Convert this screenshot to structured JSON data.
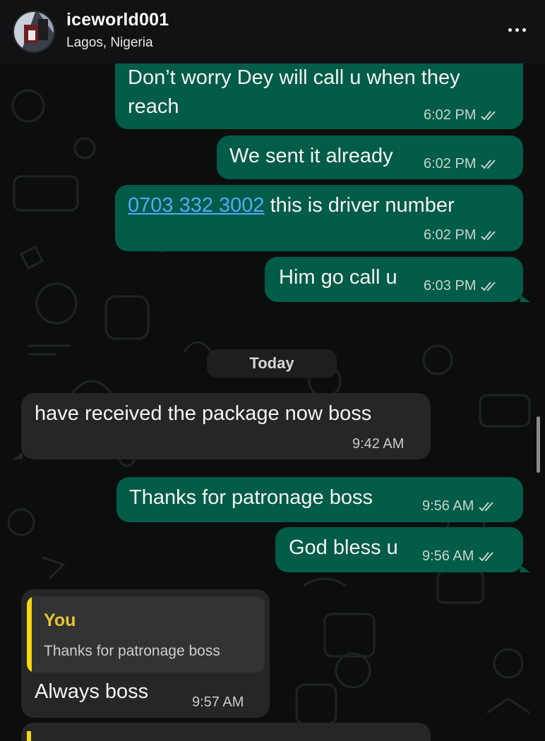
{
  "header": {
    "username": "iceworld001",
    "location": "Lagos, Nigeria",
    "more_icon": "more-horizontal-icon"
  },
  "messages": [
    {
      "direction": "outgoing",
      "text": "Don’t worry Dey will call u when they reach",
      "time": "6:02 PM",
      "status": "read"
    },
    {
      "direction": "outgoing",
      "text": "We sent it already",
      "time": "6:02 PM",
      "status": "read"
    },
    {
      "direction": "outgoing",
      "link": "0703 332 3002",
      "text": " this is driver number",
      "time": "6:02 PM",
      "status": "read"
    },
    {
      "direction": "outgoing",
      "text": "Him go call u",
      "time": "6:03 PM",
      "status": "read"
    },
    {
      "direction": "incoming",
      "text": "have received the package now boss",
      "time": "9:42 AM"
    },
    {
      "direction": "outgoing",
      "text": "Thanks for patronage boss",
      "time": "9:56 AM",
      "status": "read"
    },
    {
      "direction": "outgoing",
      "text": "God bless u",
      "time": "9:56 AM",
      "status": "read"
    },
    {
      "direction": "incoming",
      "reply_to": {
        "author": "You",
        "text": "Thanks for patronage boss"
      },
      "text": "Always boss",
      "time": "9:57 AM"
    }
  ],
  "day_separator": "Today",
  "colors": {
    "outgoing_bubble": "#035c47",
    "incoming_bubble": "#262626",
    "link": "#53a8ff",
    "quote_accent": "#f5d90a"
  }
}
